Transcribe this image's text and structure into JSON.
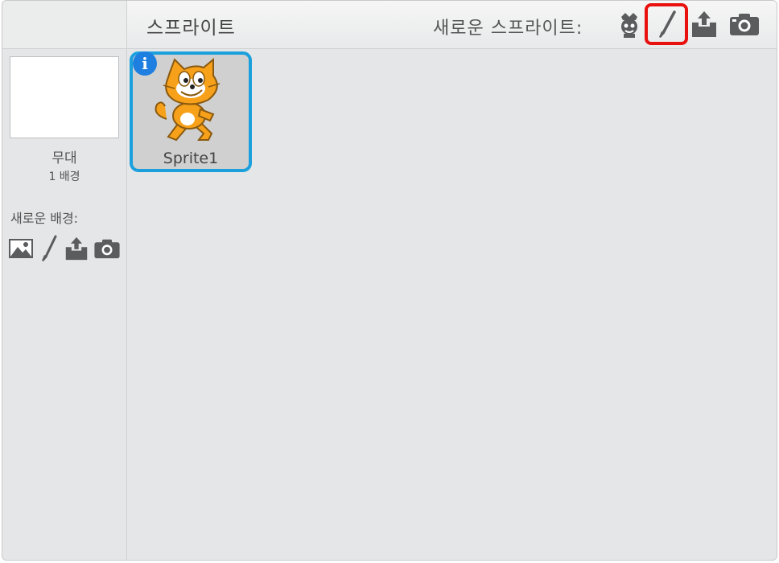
{
  "header": {
    "title": "스프라이트",
    "new_sprite_label": "새로운 스프라이트:",
    "icons": [
      "sprite-library-icon",
      "paint-brush-icon",
      "upload-icon",
      "camera-icon"
    ],
    "highlight_color": "#e8110e"
  },
  "stage": {
    "name": "무대",
    "backdrop_count": "1 배경",
    "new_backdrop_label": "새로운 배경:",
    "icons": [
      "image-library-icon",
      "paint-brush-icon",
      "upload-icon",
      "camera-icon"
    ]
  },
  "sprites": [
    {
      "name": "Sprite1",
      "info_glyph": "i",
      "selected": true,
      "border_color": "#1ca0dd"
    }
  ]
}
